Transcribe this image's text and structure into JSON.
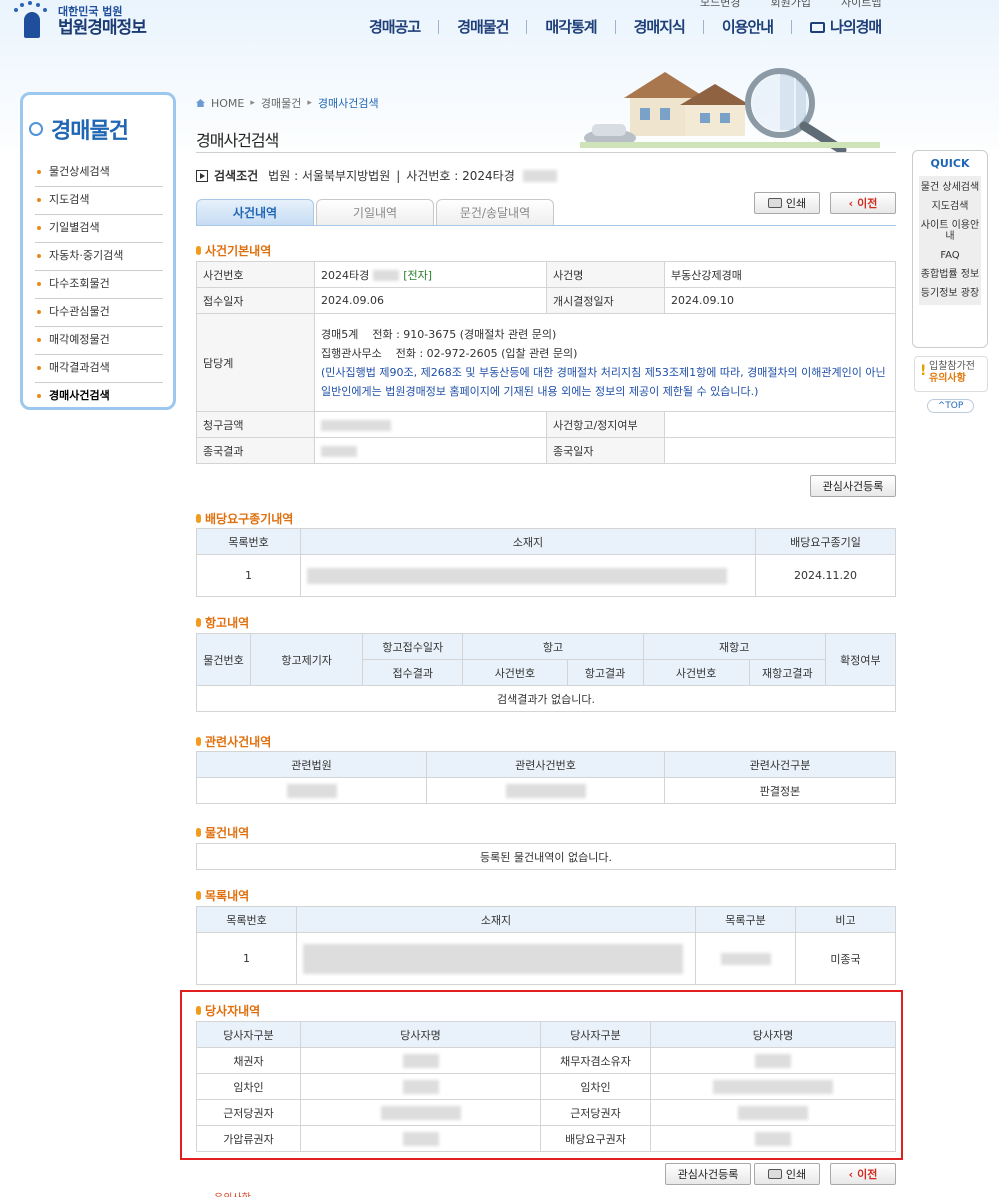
{
  "site": {
    "emblem_top": "대한민국 법원",
    "title": "법원경매정보"
  },
  "top_links": [
    "모드변경",
    "회원가입",
    "사이트맵"
  ],
  "gnb": [
    "경매공고",
    "경매물건",
    "매각통계",
    "경매지식",
    "이용안내",
    "나의경매"
  ],
  "lnb": {
    "title": "경매물건",
    "items": [
      "물건상세검색",
      "지도검색",
      "기일별검색",
      "자동차·중기검색",
      "다수조회물건",
      "다수관심물건",
      "매각예정물건",
      "매각결과검색",
      "경매사건검색"
    ]
  },
  "breadcrumb": [
    "HOME",
    "경매물건",
    "경매사건검색"
  ],
  "page_title": "경매사건검색",
  "search_cond": {
    "label": "검색조건",
    "court_label": "법원 : 서울북부지방법원",
    "case_label": "사건번호 : 2024타경"
  },
  "tabs": [
    "사건내역",
    "기일내역",
    "문건/송달내역"
  ],
  "buttons": {
    "print": "인쇄",
    "prev": "이전",
    "interest": "관심사건등록"
  },
  "basic": {
    "title": "사건기본내역",
    "case_no_label": "사건번호",
    "case_no": "2024타경",
    "e_tag": "[전자]",
    "case_name_label": "사건명",
    "case_name": "부동산강제경매",
    "receipt_label": "접수일자",
    "receipt": "2024.09.06",
    "start_label": "개시결정일자",
    "start": "2024.09.10",
    "dept_label": "담당계",
    "dept_line1": "경매5계    전화 : 910-3675 (경매절차 관련 문의)",
    "dept_line2": "집행관사무소    전화 : 02-972-2605 (입찰 관련 문의)",
    "dept_notice": "(민사집행법 제90조, 제268조 및 부동산등에 대한 경매절차 처리지침 제53조제1항에 따라, 경매절차의 이해관계인이 아닌 일반인에게는 법원경매정보 홈페이지에 기재된 내용 외에는 정보의 제공이 제한될 수 있습니다.)",
    "claim_label": "청구금액",
    "appeal_label": "사건항고/정지여부",
    "final_label": "종국결과",
    "final_date_label": "종국일자"
  },
  "dividend": {
    "title": "배당요구종기내역",
    "headers": [
      "목록번호",
      "소재지",
      "배당요구종기일"
    ],
    "rows": [
      {
        "no": "1",
        "date": "2024.11.20"
      }
    ]
  },
  "appeal": {
    "title": "항고내역",
    "h_item": "물건번호",
    "h_filer": "항고제기자",
    "h_date": "항고접수일자",
    "h_result": "접수결과",
    "h_appeal": "항고",
    "h_reappeal": "재항고",
    "h_caseno": "사건번호",
    "h_appeal_result": "항고결과",
    "h_caseno2": "사건번호",
    "h_reappeal_result": "재항고결과",
    "h_confirm": "확정여부",
    "empty": "검색결과가 없습니다."
  },
  "related": {
    "title": "관련사건내역",
    "headers": [
      "관련법원",
      "관련사건번호",
      "관련사건구분"
    ],
    "type": "판결정본"
  },
  "items": {
    "title": "물건내역",
    "empty": "등록된 물건내역이 없습니다."
  },
  "list": {
    "title": "목록내역",
    "headers": [
      "목록번호",
      "소재지",
      "목록구분",
      "비고"
    ],
    "rows": [
      {
        "no": "1",
        "note": "미종국"
      }
    ]
  },
  "parties": {
    "title": "당사자내역",
    "headers": [
      "당사자구분",
      "당사자명",
      "당사자구분",
      "당사자명"
    ],
    "rows": [
      [
        "채권자",
        "채무자겸소유자"
      ],
      [
        "임차인",
        "임차인"
      ],
      [
        "근저당권자",
        "근저당권자"
      ],
      [
        "가압류권자",
        "배당요구권자"
      ]
    ]
  },
  "quick": {
    "title": "QUICK",
    "items": [
      "물건 상세검색",
      "지도검색",
      "사이트 이용안내",
      "FAQ",
      "종합법률 정보",
      "등기정보 광장"
    ]
  },
  "caution": {
    "line1": "입찰참가전",
    "line2": "유의사항"
  },
  "totop": "^TOP",
  "bottom_warn": "유의사항"
}
